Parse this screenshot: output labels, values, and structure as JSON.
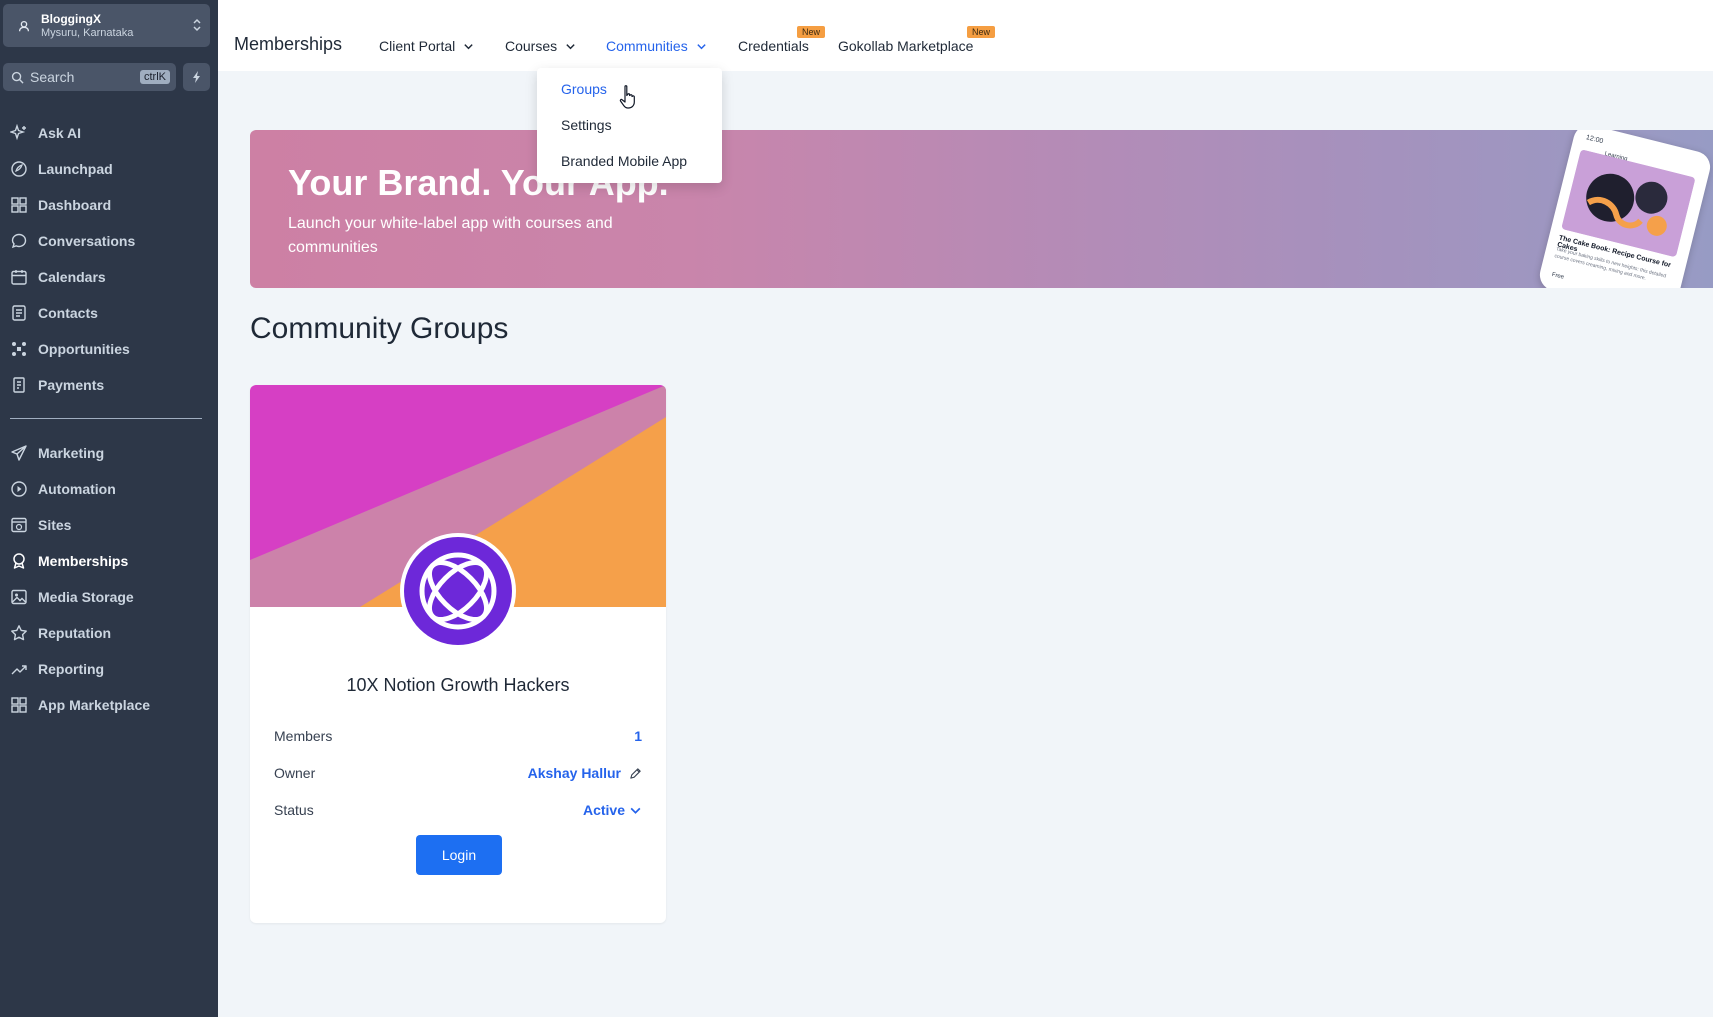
{
  "account": {
    "name": "BloggingX",
    "location": "Mysuru, Karnataka"
  },
  "search": {
    "label": "Search",
    "shortcut": "ctrlK"
  },
  "sidebar": {
    "items": [
      {
        "label": "Ask AI",
        "icon": "sparkle-icon"
      },
      {
        "label": "Launchpad",
        "icon": "rocket-icon"
      },
      {
        "label": "Dashboard",
        "icon": "grid-icon"
      },
      {
        "label": "Conversations",
        "icon": "chat-icon"
      },
      {
        "label": "Calendars",
        "icon": "calendar-icon"
      },
      {
        "label": "Contacts",
        "icon": "contacts-icon"
      },
      {
        "label": "Opportunities",
        "icon": "funnel-icon"
      },
      {
        "label": "Payments",
        "icon": "receipt-icon"
      },
      {
        "label": "Marketing",
        "icon": "send-icon"
      },
      {
        "label": "Automation",
        "icon": "play-circle-icon"
      },
      {
        "label": "Sites",
        "icon": "globe-window-icon"
      },
      {
        "label": "Memberships",
        "icon": "award-icon",
        "active": true
      },
      {
        "label": "Media Storage",
        "icon": "image-icon"
      },
      {
        "label": "Reputation",
        "icon": "star-icon"
      },
      {
        "label": "Reporting",
        "icon": "trend-icon"
      },
      {
        "label": "App Marketplace",
        "icon": "apps-icon"
      }
    ]
  },
  "topbar": {
    "title": "Memberships",
    "tabs": [
      {
        "label": "Client Portal"
      },
      {
        "label": "Courses"
      },
      {
        "label": "Communities",
        "active": true
      },
      {
        "label": "Credentials",
        "badge": "New"
      },
      {
        "label": "Gokollab Marketplace",
        "badge": "New"
      }
    ]
  },
  "dropdown": {
    "items": [
      {
        "label": "Groups",
        "active": true
      },
      {
        "label": "Settings"
      },
      {
        "label": "Branded Mobile App"
      }
    ]
  },
  "banner": {
    "title": "Your Brand. Your App.",
    "subtitle": "Launch your white-label app with courses and communities",
    "phone": {
      "time": "12:00",
      "app_label": "Learning",
      "course_title": "The Cake Book: Recipe Course for Cakes",
      "course_text": "Take your baking skills to new heights: this detailed course covers creaming, mixing and more.",
      "tag": "Free"
    }
  },
  "section": {
    "title": "Community Groups"
  },
  "group_card": {
    "name": "10X Notion Growth Hackers",
    "members_label": "Members",
    "members_value": "1",
    "owner_label": "Owner",
    "owner_value": "Akshay Hallur",
    "status_label": "Status",
    "status_value": "Active",
    "login_label": "Login"
  },
  "colors": {
    "sidebar_bg": "#2d3748",
    "accent": "#2563eb",
    "button": "#1d6ff2",
    "badge": "#f59e42",
    "cover_magenta": "#d63fc4",
    "cover_pink": "#cc82aa",
    "cover_orange": "#f5a04a",
    "avatar_purple": "#6d28d9"
  }
}
